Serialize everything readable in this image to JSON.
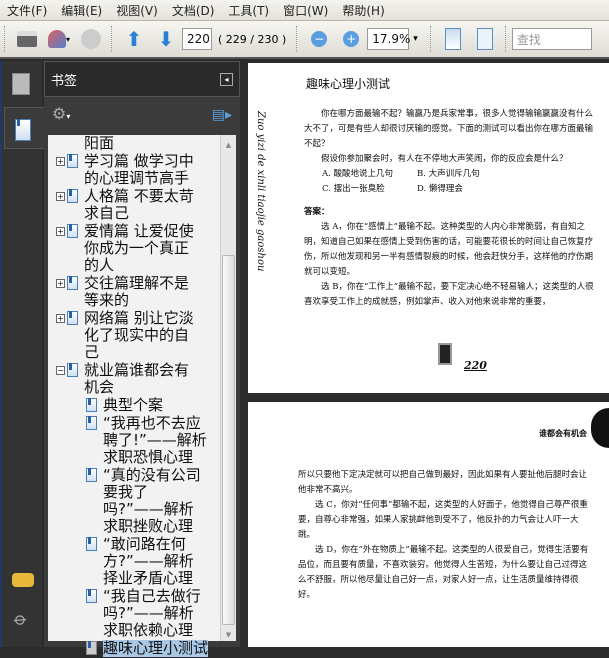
{
  "menu": [
    "文件(F)",
    "编辑(E)",
    "视图(V)",
    "文档(D)",
    "工具(T)",
    "窗口(W)",
    "帮助(H)"
  ],
  "toolbar": {
    "page_input": "220",
    "page_count": "( 229 / 230 )",
    "zoom": "17.9%",
    "search_placeholder": "查找"
  },
  "panel": {
    "title": "书签",
    "items": [
      {
        "text": "阳面",
        "level": 0,
        "expander": "none"
      },
      {
        "text": "学习篇 做学习中的心理调节高手",
        "level": 0,
        "expander": "+"
      },
      {
        "text": "人格篇 不要太苛求自己",
        "level": 0,
        "expander": "+"
      },
      {
        "text": "爱情篇 让爱促使你成为一个真正的人",
        "level": 0,
        "expander": "+"
      },
      {
        "text": "交往篇理解不是等来的",
        "level": 0,
        "expander": "+"
      },
      {
        "text": "网络篇 别让它淡化了现实中的自己",
        "level": 0,
        "expander": "+"
      },
      {
        "text": "就业篇谁都会有机会",
        "level": 0,
        "expander": "-"
      },
      {
        "text": "典型个案",
        "level": 1
      },
      {
        "text": "“我再也不去应聘了!”——解析求职恐惧心理",
        "level": 1
      },
      {
        "text": "“真的没有公司要我了吗?”——解析求职挫败心理",
        "level": 1
      },
      {
        "text": "“敢问路在何方?”——解析择业矛盾心理",
        "level": 1
      },
      {
        "text": "“我自己去做行吗?”——解析求职依赖心理",
        "level": 1
      },
      {
        "text": "趣味心理小测试",
        "level": 1,
        "selected": true
      }
    ]
  },
  "page1": {
    "title": "趣味心理小测试",
    "side_text": "Zuo yizi de xinli tiaojie gaoshou",
    "paras": [
      "你在哪方面最输不起？输赢乃是兵家常事，很多人觉得输输赢赢没有什么大不了，可是有些人却很讨厌输的感觉。下面的测试可以看出你在哪方面最输不起？",
      "假设你参加聚会时，有人在不停地大声笑闹，你的反应会是什么？"
    ],
    "options": [
      "A. 酸酸地说上几句",
      "B. 大声训斥几句",
      "C. 摆出一张臭脸",
      "D. 懒得理会"
    ],
    "answer_label": "答案：",
    "answers": [
      "选 A，你在“感情上”最输不起。这种类型的人内心非常脆弱，有自知之明，知道自己如果在感情上受到伤害的话，可能要花很长的时间让自己恢复疗伤，所以他发现和另一半有感情裂痕的时候，他会赶快分手，这样他的疗伤期就可以变短。",
      "选 B，你在“工作上”最输不起，要下定决心绝不轻易输人；这类型的人很喜欢享受工作上的成就感，例如掌声、收入对他来说非常的重要，"
    ],
    "page_number": "220"
  },
  "page2": {
    "header": "谁都会有机会",
    "paras": [
      "所以只要他下定决定就可以把自己做到最好，因此如果有人要扯他后腿时会让他非常不高兴。",
      "选 C，你对“任何事”都输不起，这类型的人好面子，他觉得自己尊严很重要，自尊心非常强，如果人家挑衅他到受不了，他反扑的力气会让人吓一大跳。",
      "选 D，你在“外在物质上”最输不起。这类型的人很爱自己，觉得生活要有品位，而且要有质量，不喜欢装穷。他觉得人生苦短，为什么要让自己过得这么不舒服，所以他尽量让自己好一点，对家人好一点，让生活质量维持得很好。"
    ]
  }
}
